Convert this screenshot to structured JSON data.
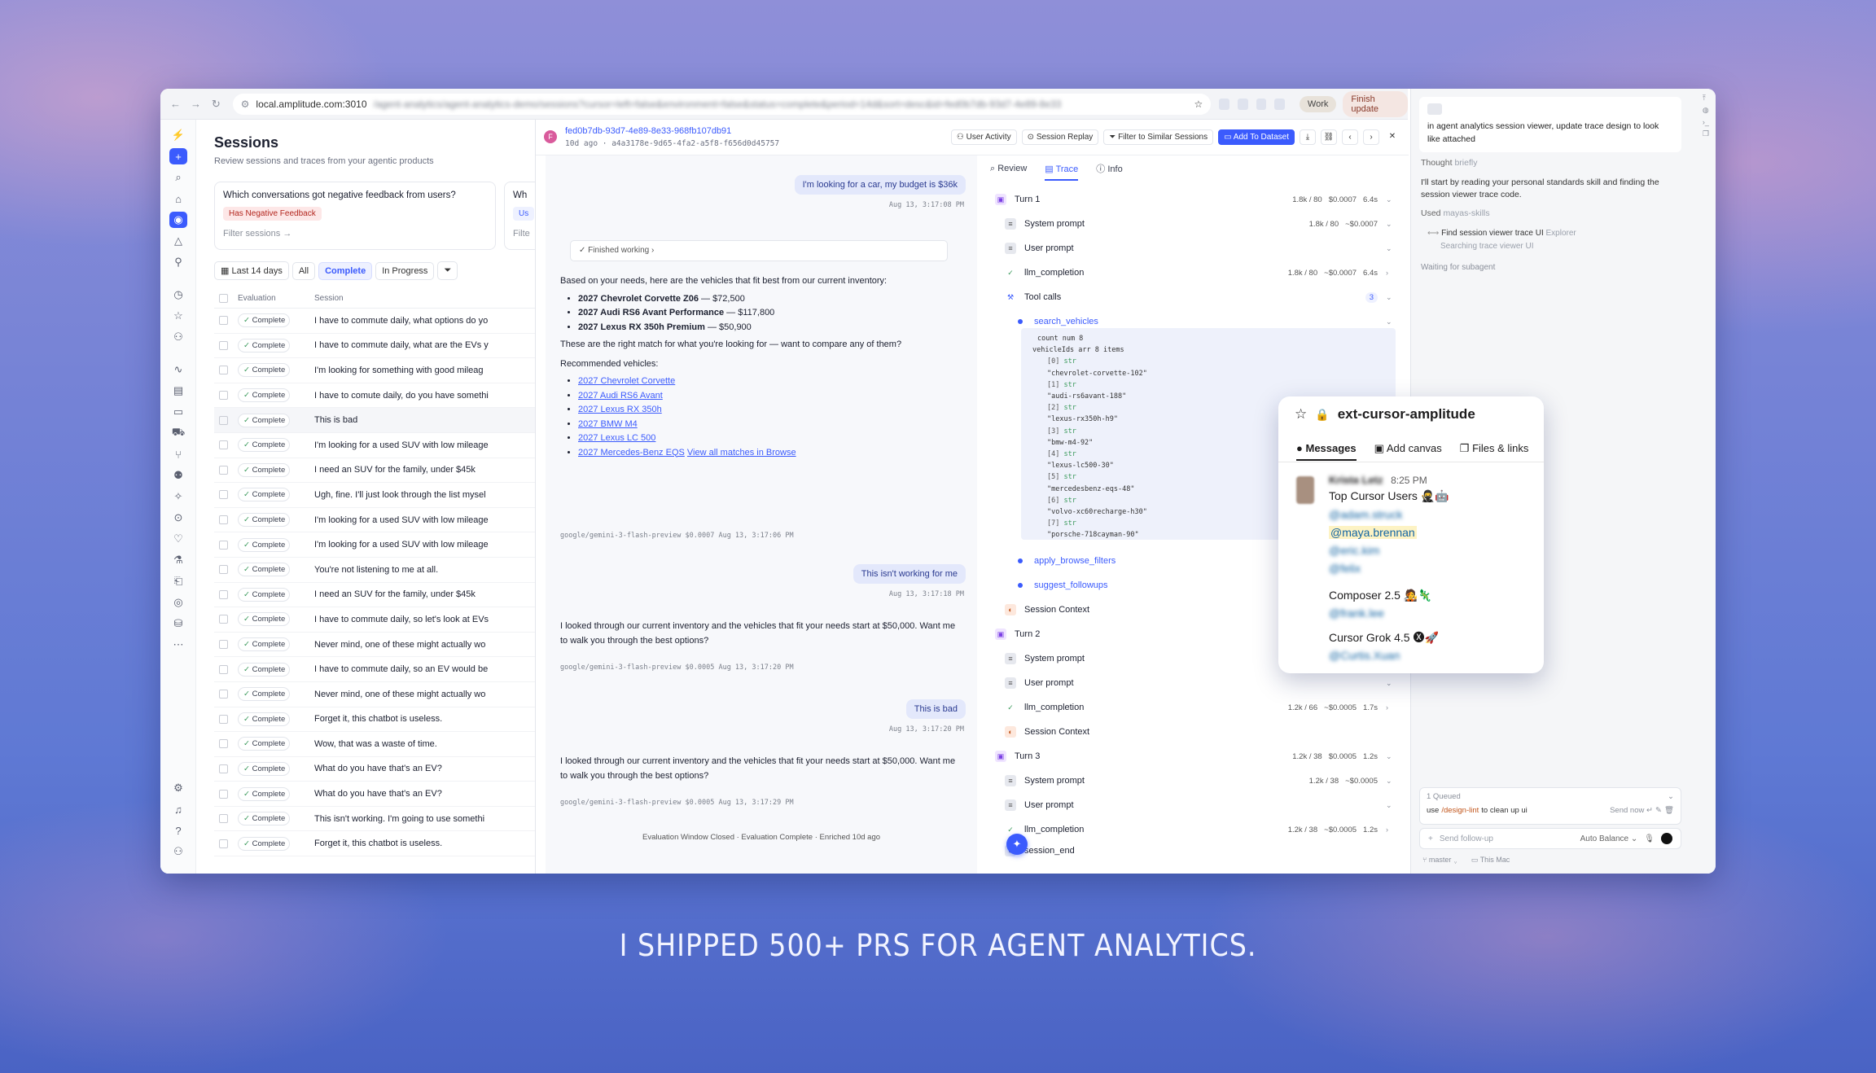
{
  "tagline": "I SHIPPED 500+ PRS FOR AGENT ANALYTICS.",
  "browser": {
    "url_prefix": "local.amplitude.com:3010",
    "url_rest": "/agent-analytics/agent-analytics-demo/sessions?cursor=left=false&environment=false&status=complete&period=14d&sort=desc&id=fed0b7db-93d7-4e89-8e33",
    "profile_label": "Work",
    "update_label": "Finish update"
  },
  "sessions": {
    "title": "Sessions",
    "subtitle": "Review sessions and traces from your agentic products",
    "cards": [
      {
        "question": "Which conversations got negative feedback from users?",
        "tag": "Has Negative Feedback",
        "filter": "Filter sessions →"
      },
      {
        "question": "Wh",
        "tag": "Us",
        "filter": "Filte"
      }
    ],
    "filters": {
      "range": "Last 14 days",
      "all": "All",
      "complete": "Complete",
      "in_progress": "In Progress"
    },
    "columns": {
      "evaluation": "Evaluation",
      "session": "Session"
    },
    "rows": [
      {
        "status": "Complete",
        "text": "I have to commute daily, what options do yo"
      },
      {
        "status": "Complete",
        "text": "I have to commute daily, what are the EVs y"
      },
      {
        "status": "Complete",
        "text": "I'm looking for something with good mileag"
      },
      {
        "status": "Complete",
        "text": "I have to comute daily, do you have somethi"
      },
      {
        "status": "Complete",
        "text": "This is bad"
      },
      {
        "status": "Complete",
        "text": "I'm looking for a used SUV with low mileage"
      },
      {
        "status": "Complete",
        "text": "I need an SUV for the family, under $45k"
      },
      {
        "status": "Complete",
        "text": "Ugh, fine. I'll just look through the list mysel"
      },
      {
        "status": "Complete",
        "text": "I'm looking for a used SUV with low mileage"
      },
      {
        "status": "Complete",
        "text": "I'm looking for a used SUV with low mileage"
      },
      {
        "status": "Complete",
        "text": "You're not listening to me at all."
      },
      {
        "status": "Complete",
        "text": "I need an SUV for the family, under $45k"
      },
      {
        "status": "Complete",
        "text": "I have to commute daily, so let's look at EVs"
      },
      {
        "status": "Complete",
        "text": "Never mind, one of these might actually wo"
      },
      {
        "status": "Complete",
        "text": "I have to commute daily, so an EV would be"
      },
      {
        "status": "Complete",
        "text": "Never mind, one of these might actually wo"
      },
      {
        "status": "Complete",
        "text": "Forget it, this chatbot is useless."
      },
      {
        "status": "Complete",
        "text": "Wow, that was a waste of time."
      },
      {
        "status": "Complete",
        "text": "What do you have that's an EV?"
      },
      {
        "status": "Complete",
        "text": "What do you have that's an EV?"
      },
      {
        "status": "Complete",
        "text": "This isn't working. I'm going to use somethi"
      },
      {
        "status": "Complete",
        "text": "Forget it, this chatbot is useless."
      }
    ]
  },
  "detail": {
    "avatar_letter": "F",
    "trace_id": "fed0b7db-93d7-4e89-8e33-968fb107db91",
    "meta": "10d ago · a4a3178e-9d65-4fa2-a5f8-f656d0d45757",
    "buttons": {
      "user_activity": "User Activity",
      "session_replay": "Session Replay",
      "filter_similar": "Filter to Similar Sessions",
      "add_dataset": "Add To Dataset"
    }
  },
  "chat": {
    "msg1": "I'm looking for a car, my budget is $36k",
    "ts1": "Aug 13, 3:17:08 PM",
    "finished": "Finished working",
    "intro": "Based on your needs, here are the vehicles that fit best from our current inventory:",
    "vehicles": [
      {
        "name": "2027 Chevrolet Corvette Z06",
        "price": " — $72,500"
      },
      {
        "name": "2027 Audi RS6 Avant Performance",
        "price": " — $117,800"
      },
      {
        "name": "2027 Lexus RX 350h Premium",
        "price": " — $50,900"
      }
    ],
    "compare": "These are the right match for what you're looking for — want to compare any of them?",
    "recommended": "Recommended vehicles:",
    "links": [
      "2027 Chevrolet Corvette",
      "2027 Audi RS6 Avant",
      "2027 Lexus RX 350h",
      "2027 BMW M4",
      "2027 Lexus LC 500",
      "2027 Mercedes-Benz EQS"
    ],
    "view_all": "View all matches in Browse",
    "model1": "google/gemini-3-flash-preview $0.0007 Aug 13, 3:17:06 PM",
    "msg2": "This isn't working for me",
    "ts2": "Aug 13, 3:17:18 PM",
    "reply2": "I looked through our current inventory and the vehicles that fit your needs start at $50,000. Want me to walk you through the best options?",
    "model2": "google/gemini-3-flash-preview $0.0005 Aug 13, 3:17:20 PM",
    "msg3": "This is bad",
    "ts3": "Aug 13, 3:17:20 PM",
    "reply3": "I looked through our current inventory and the vehicles that fit your needs start at $50,000. Want me to walk you through the best options?",
    "model3": "google/gemini-3-flash-preview $0.0005 Aug 13, 3:17:29 PM",
    "eval_line": "Evaluation Window Closed · Evaluation Complete · Enriched 10d ago"
  },
  "trace": {
    "tabs": {
      "review": "Review",
      "trace": "Trace",
      "info": "Info"
    },
    "turn1": {
      "label": "Turn 1",
      "tokens": "1.8k / 80",
      "cost": "$0.0007",
      "time": "6.4s"
    },
    "system_prompt": "System prompt",
    "user_prompt": "User prompt",
    "llm": "llm_completion",
    "tool_calls": "Tool calls",
    "tool_count": "3",
    "t1_sys": {
      "tokens": "1.8k / 80",
      "cost": "~$0.0007"
    },
    "t1_llm": {
      "tokens": "1.8k / 80",
      "cost": "~$0.0007",
      "time": "6.4s"
    },
    "search_vehicles": "search_vehicles",
    "code": {
      "count": "count num 8",
      "vehicleIds": "vehicleIds arr 8 items",
      "items": [
        {
          "i": "[0]",
          "v": "\"chevrolet-corvette-102\""
        },
        {
          "i": "[1]",
          "v": "\"audi-rs6avant-188\""
        },
        {
          "i": "[2]",
          "v": "\"lexus-rx350h-h9\""
        },
        {
          "i": "[3]",
          "v": "\"bmw-m4-92\""
        },
        {
          "i": "[4]",
          "v": "\"lexus-lc500-30\""
        },
        {
          "i": "[5]",
          "v": "\"mercedesbenz-eqs-48\""
        },
        {
          "i": "[6]",
          "v": "\"volvo-xc60recharge-h30\""
        },
        {
          "i": "[7]",
          "v": "\"porsche-718cayman-90\""
        }
      ],
      "str": "str"
    },
    "apply_browse_filters": "apply_browse_filters",
    "suggest_followups": "suggest_followups",
    "session_context": "Session Context",
    "turn2": {
      "label": "Turn 2"
    },
    "t2_llm": {
      "tokens": "1.2k / 66",
      "cost": "~$0.0005",
      "time": "1.7s"
    },
    "turn3": {
      "label": "Turn 3",
      "tokens": "1.2k / 38",
      "cost": "$0.0005",
      "time": "1.2s"
    },
    "t3_sys": {
      "tokens": "1.2k / 38",
      "cost": "~$0.0005"
    },
    "t3_llm": {
      "tokens": "1.2k / 38",
      "cost": "~$0.0005",
      "time": "1.2s"
    },
    "session_end": "session_end"
  },
  "agent": {
    "prompt": "in agent analytics session viewer, update trace design to look like attached",
    "thought": "Thought",
    "thought_mut": "briefly",
    "intro": "I'll start by reading your personal standards skill and finding the session viewer trace code.",
    "used": "Used",
    "used_mut": "mayas-skills",
    "find": "Find session viewer trace UI",
    "find_mut": "Explorer",
    "searching": "Searching trace viewer UI",
    "waiting": "Waiting for subagent",
    "queued": "1 Queued",
    "queue_pre": "use",
    "queue_cmd": "/design-lint",
    "queue_post": "to clean up ui",
    "send_now": "Send now",
    "placeholder": "Send follow-up",
    "model": "Auto Balance",
    "branch": "master",
    "machine": "This Mac"
  },
  "slack": {
    "channel": "ext-cursor-amplitude",
    "tabs": {
      "messages": "Messages",
      "canvas": "Add canvas",
      "files": "Files & links"
    },
    "author": "Krista Letz",
    "time": "8:25 PM",
    "top_users": "Top Cursor Users",
    "mention1": "@adam.struck",
    "mention2": "@maya.brennan",
    "mention3": "@eric.kim",
    "mention4": "@felix",
    "composer": "Composer 2.5",
    "mention5": "@frank.lee",
    "grok": "Cursor Grok 4.5",
    "mention6": "@Curtis.Xuan"
  }
}
